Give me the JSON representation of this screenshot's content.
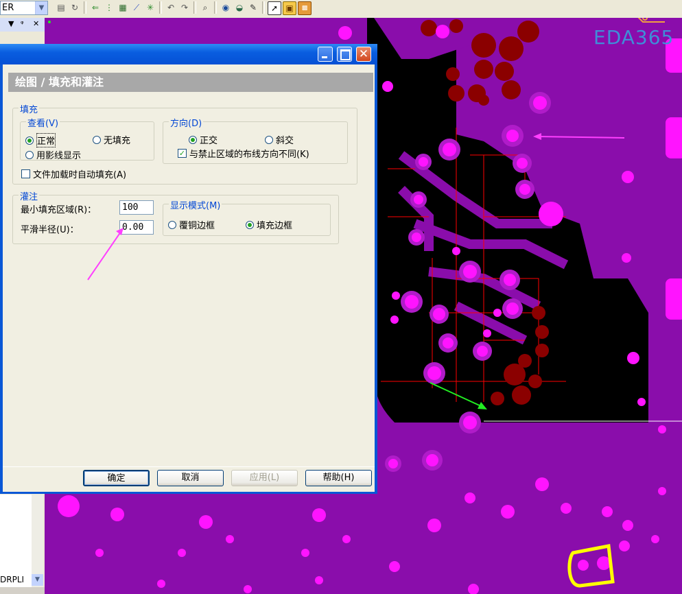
{
  "toolbar": {
    "layer_value": "ER"
  },
  "left_panel": {
    "header_glyphs": [
      "▼",
      "ᵠ",
      "✕"
    ],
    "truncated_text": "DRPLI"
  },
  "watermark": "EDA365",
  "dialog": {
    "heading": "绘图 / 填充和灌注",
    "fill_group": {
      "title": "填充",
      "view_group": {
        "title": "查看(V)",
        "normal": "正常",
        "no_fill": "无填充",
        "hatch": "用影线显示",
        "selected": "normal"
      },
      "direction_group": {
        "title": "方向(D)",
        "orthogonal": "正交",
        "diagonal": "斜交",
        "selected": "orthogonal",
        "diff_checkbox": "与禁止区域的布线方向不同(K)",
        "diff_checked": true
      },
      "auto_fill_checkbox": "文件加载时自动填充(A)",
      "auto_fill_checked": false
    },
    "pour_group": {
      "title": "灌注",
      "min_area_label": "最小填充区域(R)：",
      "min_area_value": "100",
      "smooth_radius_label": "平滑半径(U)：",
      "smooth_radius_value": "0.00",
      "display_mode": {
        "title": "显示模式(M)",
        "copper_outline": "覆铜边框",
        "fill_outline": "填充边框",
        "selected": "fill_outline"
      }
    },
    "buttons": {
      "ok": "确定",
      "cancel": "取消",
      "apply": "应用(L)",
      "help": "帮助(H)"
    }
  },
  "colors": {
    "copper": "#8a0dab",
    "pad": "#ff14ff",
    "via_dark": "#8b0000",
    "trace": "#ff0000",
    "highlight": "#ffff00",
    "xp_blue": "#0a57d6"
  }
}
